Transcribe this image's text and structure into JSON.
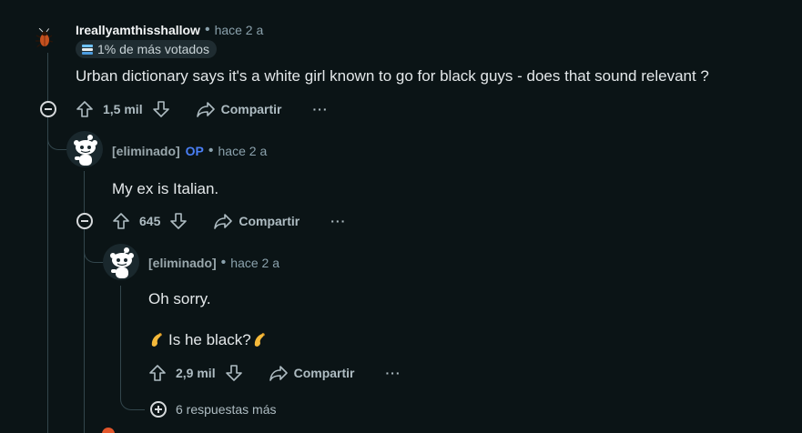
{
  "comment1": {
    "author": "Ireallyamthisshallow",
    "time": "hace 2 a",
    "badge": "1% de más votados",
    "body": "Urban dictionary says it's a white girl known to go for black guys - does that sound relevant ?",
    "votes": "1,5 mil",
    "share_label": "Compartir",
    "more_label": "···"
  },
  "comment2": {
    "author": "[eliminado]",
    "op_label": "OP",
    "time": "hace 2 a",
    "body": "My ex is Italian.",
    "votes": "645",
    "share_label": "Compartir",
    "more_label": "···"
  },
  "comment3": {
    "author": "[eliminado]",
    "time": "hace 2 a",
    "body_line1": "Oh sorry.",
    "body_line2": "Is he black?",
    "votes": "2,9 mil",
    "share_label": "Compartir",
    "more_label": "···"
  },
  "more_replies": "6 respuestas más",
  "colors": {
    "background": "#0b1416",
    "op_accent": "#4a7ff5",
    "thread_line": "#33464c"
  }
}
